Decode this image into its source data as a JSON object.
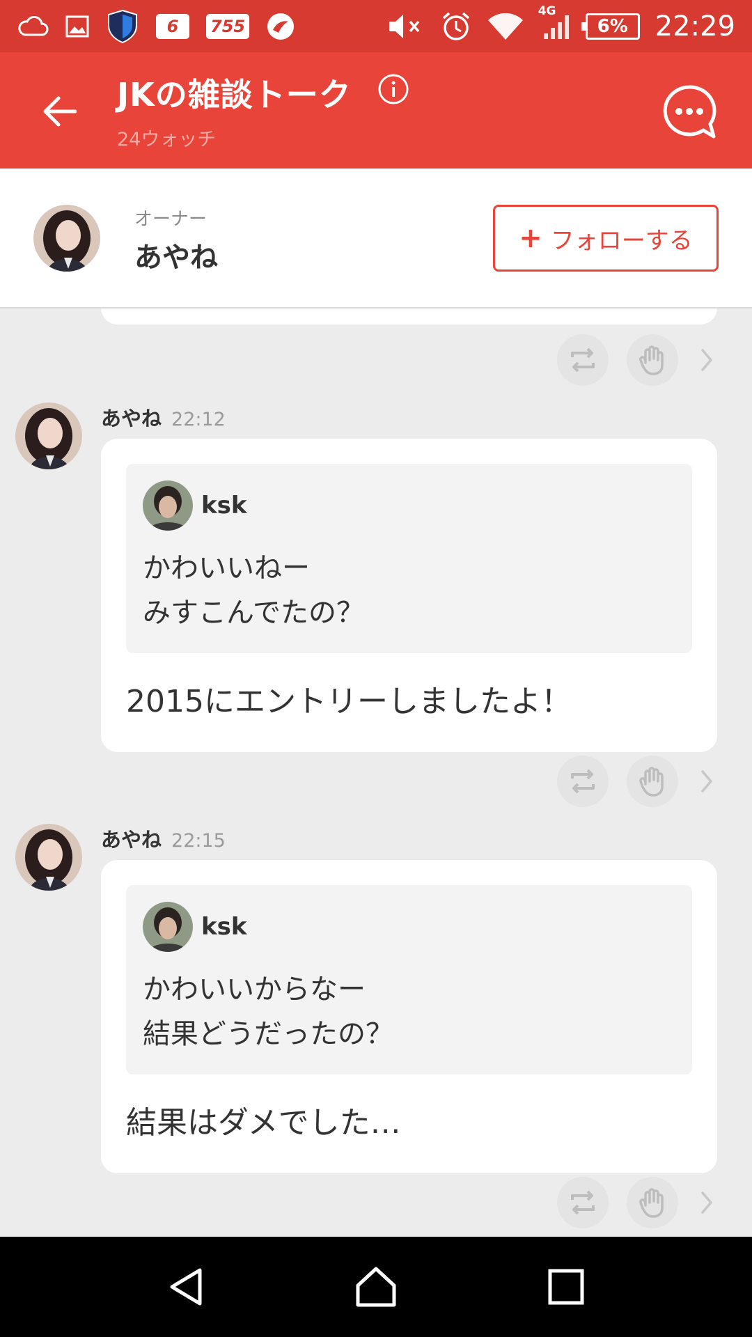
{
  "status_bar": {
    "notification_counts": [
      "6",
      "755"
    ],
    "battery_percent": "6%",
    "network_label": "4G",
    "time": "22:29"
  },
  "app_bar": {
    "title": "JKの雑談トーク",
    "subtitle": "24ウォッチ"
  },
  "owner": {
    "role": "オーナー",
    "name": "あやね",
    "follow_plus": "+",
    "follow_label": "フォローする"
  },
  "messages": [
    {
      "author": "あやね",
      "time": "22:12",
      "quote_author": "ksk",
      "quote_lines": [
        "かわいいねー",
        "みすこんでたの？"
      ],
      "reply": "2015にエントリーしましたよ！"
    },
    {
      "author": "あやね",
      "time": "22:15",
      "quote_author": "ksk",
      "quote_lines": [
        "かわいいからなー",
        "結果どうだったの？"
      ],
      "reply": "結果はダメでした…"
    }
  ],
  "colors": {
    "status_bar": "#d63a30",
    "app_bar": "#e8443a",
    "accent": "#e8443a",
    "chat_bg": "#ececec"
  },
  "icons": [
    "cloud-icon",
    "image-icon",
    "shield-icon",
    "mute-icon",
    "alarm-icon",
    "wifi-icon",
    "signal-icon",
    "battery-icon",
    "back-arrow-icon",
    "info-icon",
    "chat-bubble-icon",
    "retalk-icon",
    "clap-icon",
    "chevron-right-icon",
    "nav-back-icon",
    "nav-home-icon",
    "nav-recents-icon"
  ]
}
